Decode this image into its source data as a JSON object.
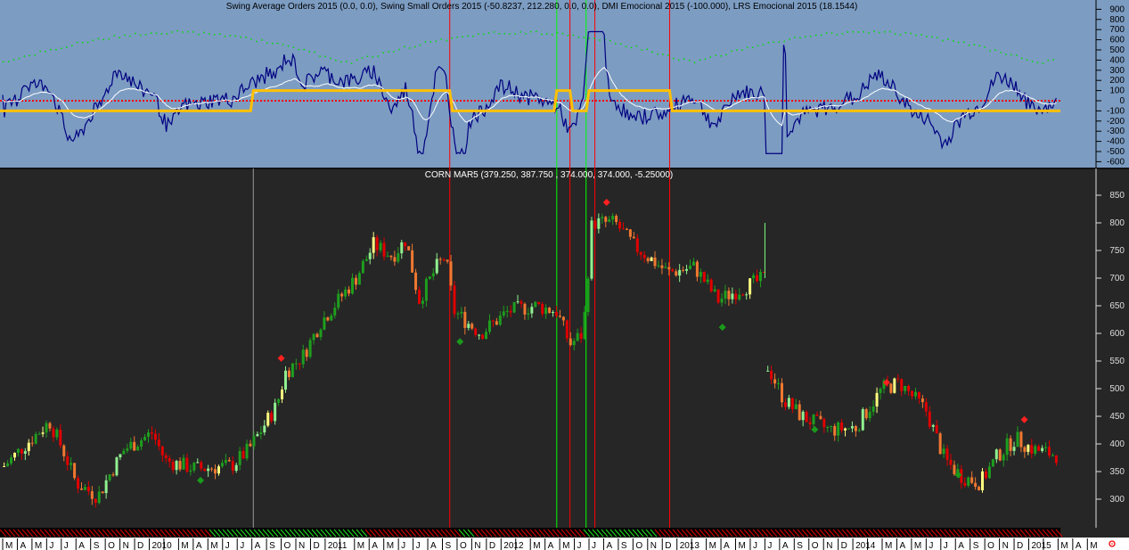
{
  "indicator_pane": {
    "title": "Swing Average Orders 2015 (0.0, 0.0), Swing Small Orders 2015 (-50.8237, 212.280, 0.0, 0.0), DMI Emocional 2015 (-100.000), LRS Emocional 2015 (18.1544)",
    "axis_labels": [
      "900",
      "800",
      "700",
      "600",
      "500",
      "400",
      "300",
      "200",
      "100",
      "0",
      "-100",
      "-200",
      "-300",
      "-400",
      "-500",
      "-600"
    ],
    "colors": {
      "bg": "#7c9cc2",
      "oscillator": "#000080",
      "signal": "#ffffff",
      "dmi": "#ffc000",
      "green_dots": "#00e000",
      "red_dots": "#ff0000"
    }
  },
  "price_pane": {
    "title": "CORN MAR5 (379.250, 387.750 , 374.000, 374.000, -5.25000)",
    "axis_labels": [
      "850",
      "800",
      "750",
      "700",
      "650",
      "600",
      "550",
      "500",
      "450",
      "400",
      "350",
      "300"
    ]
  },
  "time_axis": {
    "labels": [
      "M",
      "A",
      "M",
      "J",
      "J",
      "A",
      "S",
      "O",
      "N",
      "D",
      "2010",
      "",
      "M",
      "A",
      "M",
      "J",
      "J",
      "A",
      "S",
      "O",
      "N",
      "D",
      "2011",
      "",
      "M",
      "A",
      "M",
      "J",
      "J",
      "A",
      "S",
      "O",
      "N",
      "D",
      "2012",
      "",
      "M",
      "A",
      "M",
      "J",
      "J",
      "A",
      "S",
      "O",
      "N",
      "D",
      "2013",
      "",
      "M",
      "A",
      "M",
      "J",
      "J",
      "A",
      "S",
      "O",
      "N",
      "D",
      "2014",
      "",
      "M",
      "A",
      "M",
      "J",
      "J",
      "A",
      "S",
      "O",
      "N",
      "D",
      "2015",
      "",
      "M",
      "A",
      "M"
    ],
    "corner_icon": "settings-icon"
  },
  "chart_data": {
    "type": "candlestick",
    "x_unit": "months since Mar 2009",
    "y_range": [
      250,
      880
    ],
    "price_path_contract1": [
      [
        0.1,
        360
      ],
      [
        1.6,
        400
      ],
      [
        3.2,
        440
      ],
      [
        4.1,
        390
      ],
      [
        5.0,
        330
      ],
      [
        6.5,
        305
      ],
      [
        7.4,
        350
      ],
      [
        8.3,
        390
      ],
      [
        10.2,
        420
      ],
      [
        11.1,
        370
      ],
      [
        13.2,
        355
      ],
      [
        15.6,
        360
      ],
      [
        16.8,
        390
      ],
      [
        18.7,
        470
      ],
      [
        19.3,
        530
      ],
      [
        20.5,
        560
      ],
      [
        21.7,
        620
      ],
      [
        24.1,
        700
      ],
      [
        25.3,
        760
      ],
      [
        26.6,
        740
      ],
      [
        27.5,
        770
      ],
      [
        28.4,
        660
      ],
      [
        29.6,
        720
      ],
      [
        30.2,
        740
      ],
      [
        30.8,
        640
      ],
      [
        32.6,
        600
      ],
      [
        34.5,
        640
      ],
      [
        36.3,
        650
      ],
      [
        37.8,
        640
      ],
      [
        38.7,
        580
      ],
      [
        39.6,
        600
      ],
      [
        40.2,
        800
      ],
      [
        41.8,
        800
      ],
      [
        43.0,
        760
      ],
      [
        45.4,
        710
      ],
      [
        47.2,
        720
      ],
      [
        48.8,
        660
      ],
      [
        50.3,
        680
      ],
      [
        52.0,
        700
      ]
    ],
    "price_path_contract2": [
      [
        52.2,
        540
      ],
      [
        53.3,
        480
      ],
      [
        54.5,
        450
      ],
      [
        56.4,
        425
      ],
      [
        58.2,
        430
      ],
      [
        60.0,
        500
      ],
      [
        61.2,
        510
      ],
      [
        63.0,
        460
      ],
      [
        64.3,
        370
      ],
      [
        65.5,
        340
      ],
      [
        66.7,
        330
      ],
      [
        67.9,
        380
      ],
      [
        69.1,
        410
      ],
      [
        70.3,
        390
      ],
      [
        71.9,
        380
      ]
    ],
    "sell_markers": [
      [
        19.0,
        555
      ],
      [
        41.2,
        837
      ],
      [
        60.3,
        511
      ],
      [
        69.7,
        444
      ]
    ],
    "buy_markers": [
      [
        13.5,
        334
      ],
      [
        31.2,
        585
      ],
      [
        49.1,
        611
      ],
      [
        55.4,
        426
      ],
      [
        65.2,
        344
      ]
    ],
    "red_vlines": [
      30.5,
      38.7,
      40.4,
      45.5
    ],
    "green_vlines": [
      37.8,
      39.8
    ],
    "grey_vlines": [
      17.1
    ],
    "dmi_high_periods": [
      [
        17.1,
        30.5
      ],
      [
        37.8,
        38.7
      ],
      [
        40.0,
        45.5
      ]
    ],
    "regime_green_periods": [
      [
        14.0,
        24.7
      ],
      [
        31.0,
        32.0
      ],
      [
        39.6,
        44.4
      ]
    ],
    "indicator_range": [
      -650,
      950
    ]
  }
}
